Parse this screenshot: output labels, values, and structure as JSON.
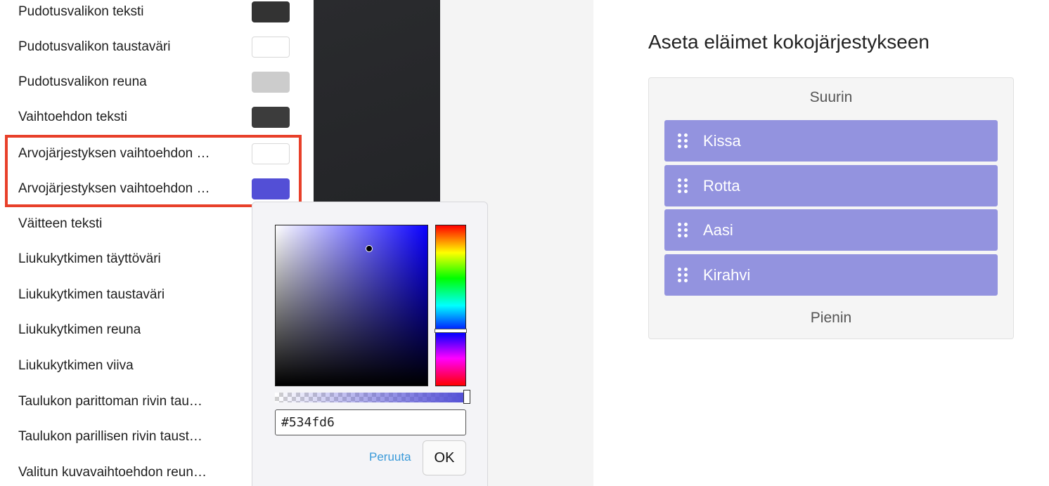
{
  "settings": {
    "rows": [
      {
        "label": "Pudotusvalikon teksti",
        "color": "#333333"
      },
      {
        "label": "Pudotusvalikon taustaväri",
        "color": "#ffffff"
      },
      {
        "label": "Pudotusvalikon reuna",
        "color": "#cccccc"
      },
      {
        "label": "Vaihtoehdon teksti",
        "color": "#3c3c3c"
      },
      {
        "label": "Arvojärjestyksen vaihtoehdon …",
        "color": "#ffffff"
      },
      {
        "label": "Arvojärjestyksen vaihtoehdon …",
        "color": "#534fd6"
      },
      {
        "label": "Väitteen teksti"
      },
      {
        "label": "Liukukytkimen täyttöväri"
      },
      {
        "label": "Liukukytkimen taustaväri"
      },
      {
        "label": "Liukukytkimen reuna"
      },
      {
        "label": "Liukukytkimen viiva"
      },
      {
        "label": "Taulukon parittoman rivin tau…"
      },
      {
        "label": "Taulukon parillisen rivin taust…"
      },
      {
        "label": "Valitun kuvavaihtoehdon reun…"
      }
    ]
  },
  "picker": {
    "hex_value": "#534fd6",
    "cancel_label": "Peruuta",
    "ok_label": "OK"
  },
  "preview": {
    "title": "Aseta eläimet kokojärjestykseen",
    "top_label": "Suurin",
    "bottom_label": "Pienin",
    "items": [
      "Kissa",
      "Rotta",
      "Aasi",
      "Kirahvi"
    ],
    "item_color": "#9393df"
  }
}
